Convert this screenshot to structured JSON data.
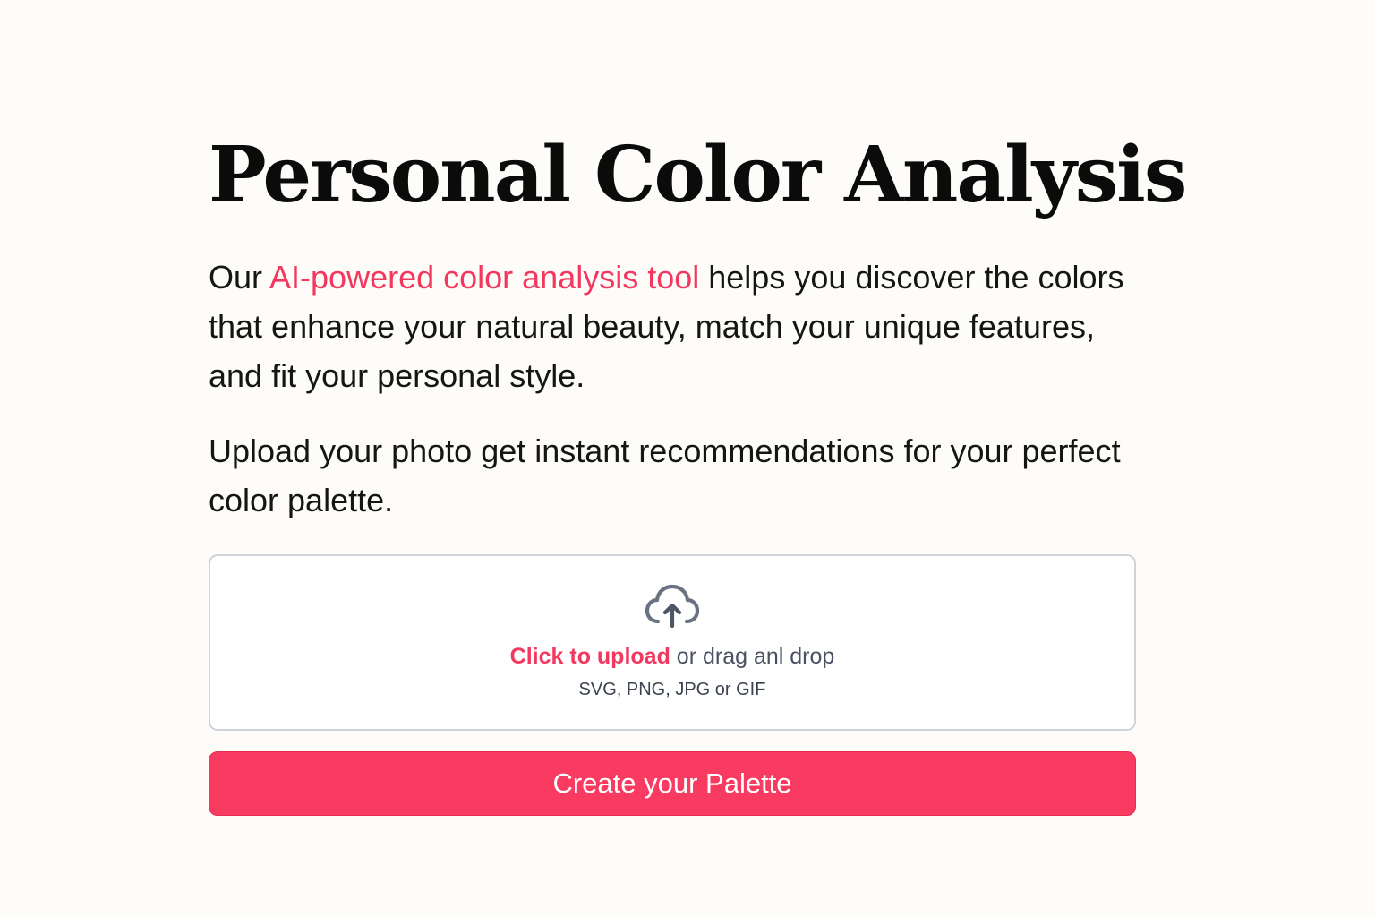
{
  "hero": {
    "title": "Personal Color Analysis",
    "intro": {
      "before": "Our ",
      "highlight": "AI-powered color analysis tool",
      "after": " helps you discover the colors that enhance your natural beauty, match your unique features, and fit your personal style."
    },
    "instruction": "Upload your photo get instant recommendations for your perfect color palette."
  },
  "upload": {
    "icon": "cloud-upload-icon",
    "click_label": "Click to upload",
    "drag_text": " or drag anl drop",
    "formats": "SVG, PNG, JPG or GIF"
  },
  "actions": {
    "create_label": "Create your Palette"
  },
  "colors": {
    "background": "#fdfcf8",
    "accent": "#f2385f",
    "button": "#f93a61",
    "border": "#cfd3db"
  }
}
